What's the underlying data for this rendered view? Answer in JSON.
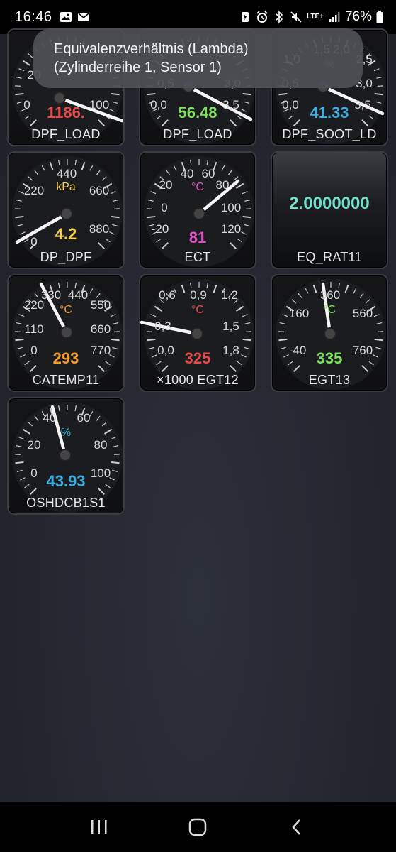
{
  "status_bar": {
    "time": "16:46",
    "battery": "76%",
    "network": "LTE+"
  },
  "toast": {
    "line1": "Equivalenzverhältnis (Lambda)",
    "line2": "(Zylinderreihe 1, Sensor 1)"
  },
  "gauges": [
    {
      "label": "DPF_LOAD",
      "value": "1186.",
      "value_color": "#e84a4a",
      "unit": "",
      "ticks": [
        "0",
        "20",
        "100"
      ]
    },
    {
      "label": "DPF_LOAD",
      "value": "56.48",
      "value_color": "#7de05c",
      "unit": "",
      "ticks": [
        "0,0",
        "0,5",
        "3,0",
        "3,5"
      ]
    },
    {
      "label": "DPF_SOOT_LD",
      "value": "41.33",
      "value_color": "#3aaee0",
      "unit": "%",
      "ticks": [
        "0,0",
        "0,5",
        "1,0",
        "1,5",
        "2,0",
        "2,5",
        "3,0",
        "3,5"
      ]
    },
    {
      "label": "DP_DPF",
      "value": "4.2",
      "value_color": "#f2d04a",
      "unit": "kPa",
      "unit_color": "#f2d04a",
      "ticks": [
        "0",
        "220",
        "440",
        "660",
        "880"
      ]
    },
    {
      "label": "ECT",
      "value": "81",
      "value_color": "#e052c8",
      "unit": "°C",
      "unit_color": "#e052c8",
      "ticks": [
        "-20",
        "0",
        "20",
        "40",
        "60",
        "80",
        "100",
        "120"
      ]
    },
    {
      "label": "EQ_RAT11",
      "value": "2.0000000",
      "value_color": "#6fe0c8",
      "digital": true
    },
    {
      "label": "CATEMP11",
      "value": "293",
      "value_color": "#f29a2e",
      "unit": "°C",
      "unit_color": "#f29a2e",
      "ticks": [
        "0",
        "110",
        "220",
        "330",
        "440",
        "550",
        "660",
        "770"
      ]
    },
    {
      "label": "×1000 EGT12",
      "value": "325",
      "value_color": "#e84a4a",
      "unit": "°C",
      "unit_color": "#e84a4a",
      "ticks": [
        "0,0",
        "0,3",
        "0,6",
        "0,9",
        "1,2",
        "1,5",
        "1,8"
      ]
    },
    {
      "label": "EGT13",
      "value": "335",
      "value_color": "#7de05c",
      "unit": "°C",
      "unit_color": "#7de05c",
      "ticks": [
        "-40",
        "160",
        "360",
        "560",
        "760"
      ]
    },
    {
      "label": "OSHDCB1S1",
      "value": "43.93",
      "value_color": "#3aaee0",
      "unit": "%",
      "unit_color": "#3aaee0",
      "ticks": [
        "0",
        "20",
        "40",
        "60",
        "80",
        "100"
      ]
    }
  ]
}
